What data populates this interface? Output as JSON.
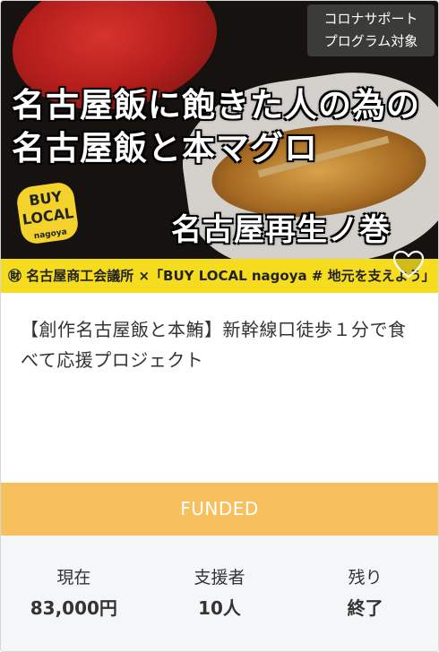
{
  "thumbnail": {
    "badge_line1": "コロナサポート",
    "badge_line2": "プログラム対象",
    "headline_line1": "名古屋飯に飽きた人の為の",
    "headline_line2": "名古屋飯と本マグロ",
    "subline": "名古屋再生ノ巻",
    "buy_local_top": "BUY",
    "buy_local_bottom": "LOCAL",
    "buy_local_small": "nagoya",
    "band_text": "㊖ 名古屋商工会議所 ×「BUY LOCAL nagoya # 地元を支えよう」"
  },
  "project": {
    "title": "【創作名古屋飯と本鮪】新幹線口徒歩１分で食べて応援プロジェクト",
    "status": "FUNDED"
  },
  "stats": {
    "current_label": "現在",
    "current_value": "83,000円",
    "backers_label": "支援者",
    "backers_value": "10人",
    "remaining_label": "残り",
    "remaining_value": "終了"
  },
  "icons": {
    "favorite": "heart-icon"
  },
  "colors": {
    "funded_bar": "#f7c05d",
    "stats_bg": "#f4f6f8",
    "band": "#f5dc1e"
  }
}
